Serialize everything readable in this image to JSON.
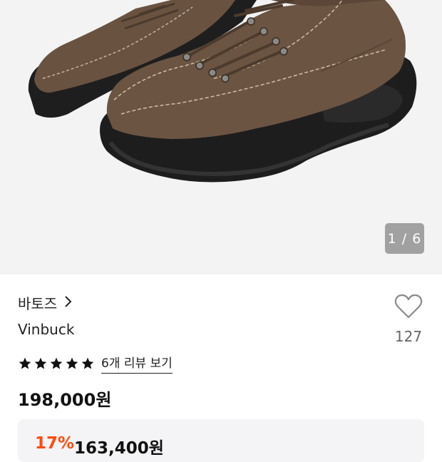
{
  "gallery": {
    "image_alt": "brown nubuck low-cut hiking shoes",
    "counter": "1 / 6"
  },
  "product": {
    "brand": "바토즈",
    "name": "Vinbuck",
    "wish_count": "127",
    "rating": 5,
    "review_link": "6개 리뷰 보기",
    "price": "198,000원"
  },
  "discount": {
    "rate": "17%",
    "price": "163,400원"
  },
  "colors": {
    "accent": "#ff4a0b",
    "star": "#111111",
    "leather": "#6b5442",
    "sole": "#1d1d1d"
  },
  "icons": {
    "brand_arrow": "chevron-right-icon",
    "wish": "heart-outline-icon",
    "star": "star-filled-icon"
  }
}
